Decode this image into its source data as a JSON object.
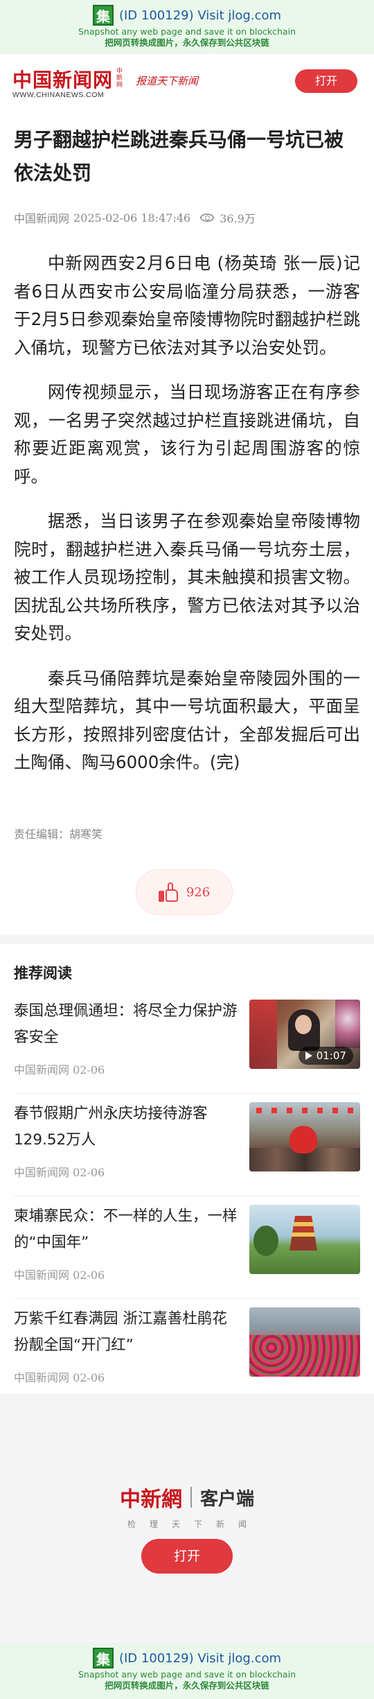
{
  "jlog": {
    "id_text": "(ID 100129) Visit jlog.com",
    "line1": "Snapshot any web page and save it on blockchain",
    "line2": "把网页转换成图片，永久保存到公共区块链",
    "logo_char": "集"
  },
  "header": {
    "logo_cn": "中国新闻网",
    "logo_small": "中新网",
    "logo_en": "WWW.CHINANEWS.COM",
    "slogan": "报道天下新闻",
    "open_label": "打开"
  },
  "article": {
    "title": "男子翻越护栏跳进秦兵马俑一号坑已被依法处罚",
    "source": "中国新闻网",
    "datetime": "2025-02-06 18:47:46",
    "views": "36.9万",
    "paragraphs": [
      "中新网西安2月6日电 (杨英琦 张一辰)记者6日从西安市公安局临潼分局获悉，一游客于2月5日参观秦始皇帝陵博物院时翻越护栏跳入俑坑，现警方已依法对其予以治安处罚。",
      "网传视频显示，当日现场游客正在有序参观，一名男子突然越过护栏直接跳进俑坑，自称要近距离观赏，该行为引起周围游客的惊呼。",
      "据悉，当日该男子在参观秦始皇帝陵博物院时，翻越护栏进入秦兵马俑一号坑夯土层，被工作人员现场控制，其未触摸和损害文物。因扰乱公共场所秩序，警方已依法对其予以治安处罚。",
      "秦兵马俑陪葬坑是秦始皇帝陵园外围的一组大型陪葬坑，其中一号坑面积最大，平面呈长方形，按照排列密度估计，全部发掘后可出土陶俑、陶马6000余件。(完)"
    ],
    "editor": "责任编辑：胡寒笑",
    "likes": "926"
  },
  "recommend": {
    "heading": "推荐阅读",
    "items": [
      {
        "title": "泰国总理佩通坦：将尽全力保护游客安全",
        "source": "中国新闻网 02-06",
        "duration": "01:07"
      },
      {
        "title": "春节假期广州永庆坊接待游客129.52万人",
        "source": "中国新闻网 02-06"
      },
      {
        "title": "柬埔寨民众：不一样的人生，一样的“中国年”",
        "source": "中国新闻网 02-06"
      },
      {
        "title": "万紫千红春满园 浙江嘉善杜鹃花扮靓全国“开门红”",
        "source": "中国新闻网 02-06"
      }
    ]
  },
  "app_promo": {
    "brand": "中新網",
    "name": "客户端",
    "tagline": "检理天下新闻",
    "open_label": "打开"
  },
  "colors": {
    "brand_red": "#c8161d",
    "button_red": "#e0393e",
    "jlog_green": "#2b8a36"
  }
}
